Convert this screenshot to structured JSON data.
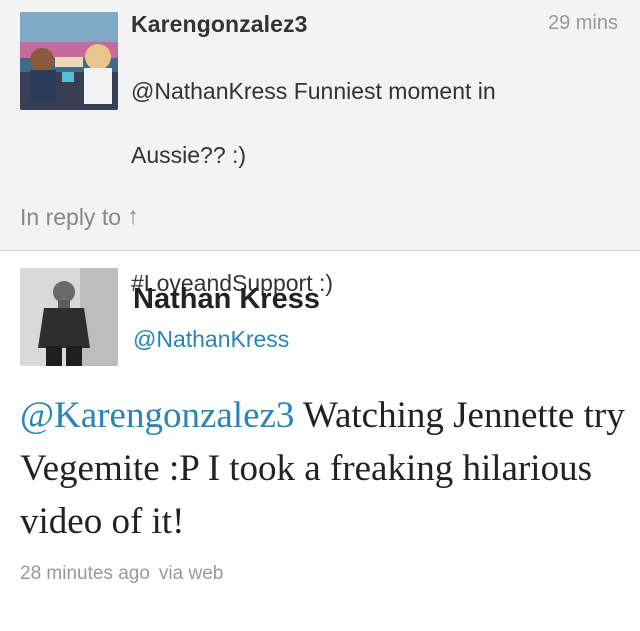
{
  "reply": {
    "username": "Karengonzalez3",
    "time": "29 mins",
    "text_line1": "@NathanKress Funniest moment in",
    "text_line2": "Aussie?? :)",
    "text_line3": "",
    "text_line4": "#LoveandSupport :)",
    "in_reply_label": "In reply to",
    "in_reply_arrow": "↑",
    "avatar_icon": "profile-photo"
  },
  "tweet": {
    "name": "Nathan Kress",
    "handle": "@NathanKress",
    "mention": "@Karengonzalez3",
    "text": " Watching Jennette try Vegemite :P I took a freaking hilarious video of it!",
    "timestamp": "28 minutes ago",
    "source": "via web",
    "avatar_icon": "profile-photo"
  },
  "colors": {
    "link": "#2a85b5",
    "reply_bg": "#f3f3f3",
    "meta_gray": "#999999"
  }
}
